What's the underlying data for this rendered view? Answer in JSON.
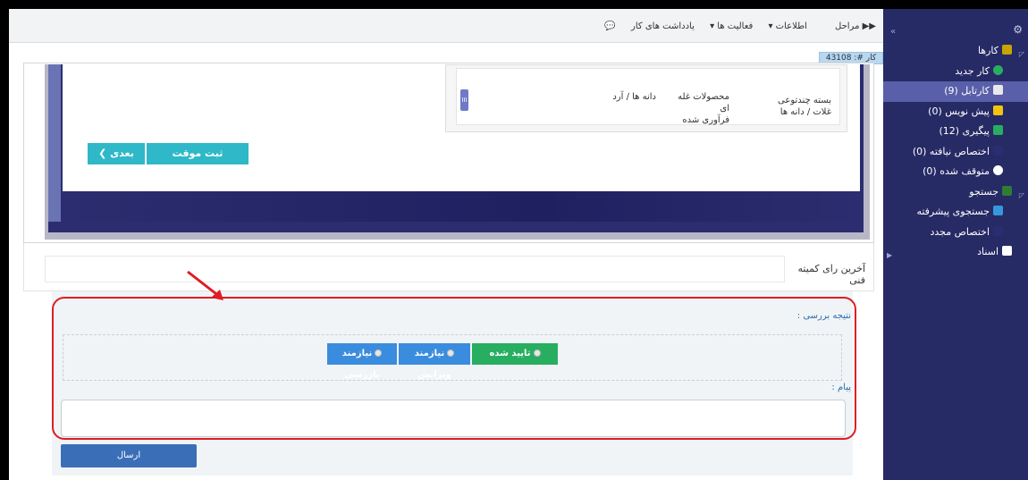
{
  "topbar": {
    "nav": [
      "مراحل",
      "اطلاعات ▾",
      "فعالیت ها ▾",
      "یادداشت های کار"
    ],
    "case_tab": "کار #: 43108"
  },
  "sidebar": {
    "items": [
      {
        "label": "کارها",
        "color": "#c8a400"
      },
      {
        "label": "کار جدید",
        "color": "#27ae60"
      },
      {
        "label": "کارتابل (9)",
        "color": "#1e7b34"
      },
      {
        "label": "پیش نویس (0)",
        "color": "#f1c40f"
      },
      {
        "label": "پیگیری (12)",
        "color": "#27ae60"
      },
      {
        "label": "اختصاص نیافته (0)",
        "color": "#2b2d70"
      },
      {
        "label": "متوقف شده (0)",
        "color": "#ffffff"
      },
      {
        "label": "جستجو",
        "color": "#2e7d32"
      },
      {
        "label": "جستجوی پیشرفته",
        "color": "#3498db"
      },
      {
        "label": "اختصاص مجدد",
        "color": "#2b2d70"
      },
      {
        "label": "اسناد",
        "color": "#ffffff"
      }
    ]
  },
  "products": {
    "col1": [
      "بسته چندتوعی",
      "غلات / دانه ها"
    ],
    "col2": [
      "محصولات غله ای",
      "فرآوری شده"
    ],
    "col3": [
      "دانه ها / آرد"
    ],
    "handle": "III"
  },
  "actions": {
    "save_temp": "ثبت موقت",
    "next": "بعدی ❯"
  },
  "committee": {
    "label": "آخرین رای کمیته فنی"
  },
  "review": {
    "title": "نتیجه بررسی :",
    "options": [
      "تایید شده",
      "نیازمند ویرایش",
      "نیازمند بازرسی"
    ],
    "message_label": "پیام :",
    "send": "ارسال"
  },
  "colors": {
    "sidebar_bg": "#262a65",
    "sidebar_active": "#5a5fa9",
    "accent_teal": "#2fb8c7",
    "approved": "#27ae60",
    "option_blue": "#3a8dde",
    "annotation_red": "#e01b24"
  }
}
